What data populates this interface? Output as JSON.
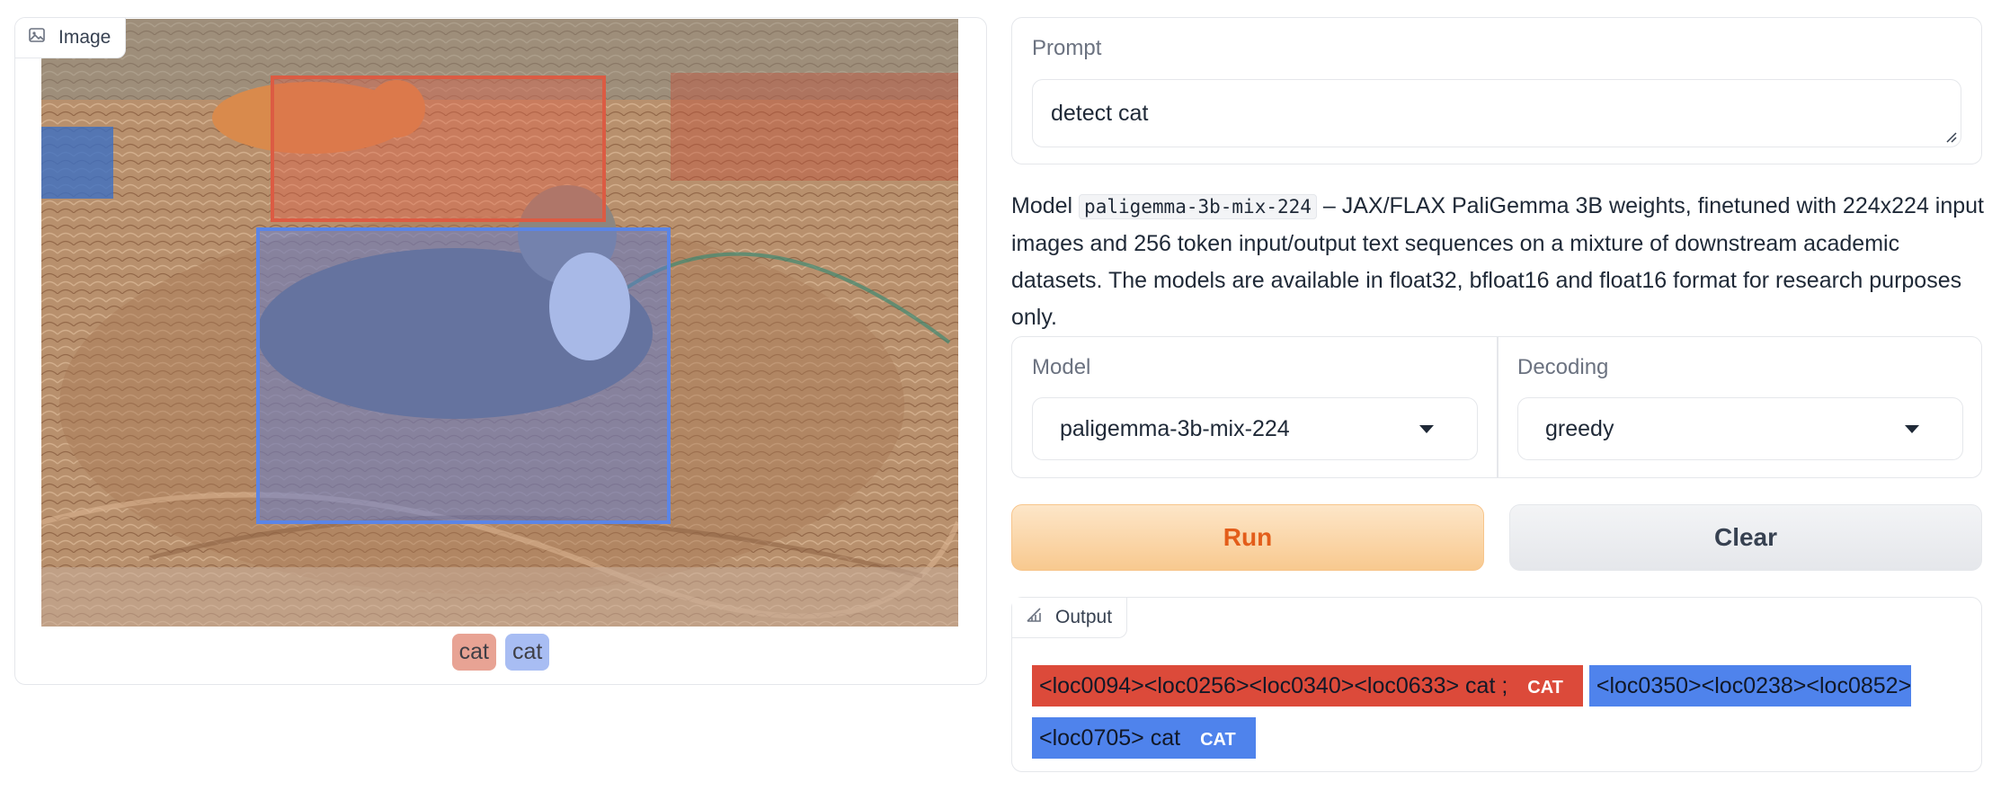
{
  "image_block": {
    "label": "Image",
    "legend": [
      "cat",
      "cat"
    ],
    "colors": {
      "box_1": "#dc5b43",
      "box_2": "#5b85e6"
    }
  },
  "prompt": {
    "label": "Prompt",
    "value": "detect cat"
  },
  "description": {
    "prefix": "Model ",
    "model_code": "paligemma-3b-mix-224",
    "text": " – JAX/FLAX PaliGemma 3B weights, finetuned with 224x224 input images and 256 token input/output text sequences on a mixture of downstream academic datasets. The models are available in float32, bfloat16 and float16 format for research purposes only."
  },
  "model_select": {
    "label": "Model",
    "value": "paligemma-3b-mix-224"
  },
  "decoding_select": {
    "label": "Decoding",
    "value": "greedy"
  },
  "buttons": {
    "run": "Run",
    "clear": "Clear"
  },
  "output": {
    "label": "Output",
    "segments": [
      {
        "text": "<loc0094><loc0256><loc0340><loc0633> cat ;",
        "tag": "CAT",
        "color": "#dc4a3a"
      },
      {
        "text": "<loc0350><loc0238><loc0852><loc0705> cat",
        "tag": "CAT",
        "color": "#4f83ec"
      }
    ]
  },
  "icons": {
    "image_block": "image-icon",
    "output_block": "chart-icon",
    "dropdown": "caret-down-icon"
  }
}
